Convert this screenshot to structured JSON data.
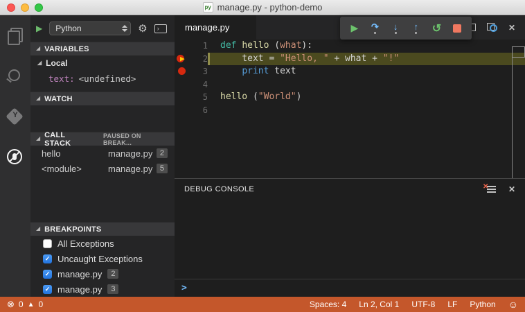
{
  "window": {
    "title": "manage.py - python-demo",
    "file_icon_label": "py"
  },
  "activity_bar": {
    "items": [
      "explorer",
      "search",
      "git",
      "debug"
    ],
    "active": "debug"
  },
  "debug_sidebar": {
    "config_dropdown": "Python",
    "git_glyph": "Y",
    "sections": {
      "variables": {
        "label": "VARIABLES",
        "scope": "Local",
        "entries": [
          {
            "name": "text:",
            "value": "<undefined>"
          }
        ]
      },
      "watch": {
        "label": "WATCH"
      },
      "call_stack": {
        "label": "CALL STACK",
        "status": "PAUSED ON BREAK...",
        "frames": [
          {
            "name": "hello",
            "file": "manage.py",
            "line": "2"
          },
          {
            "name": "<module>",
            "file": "manage.py",
            "line": "5"
          }
        ]
      },
      "breakpoints": {
        "label": "BREAKPOINTS",
        "items": [
          {
            "label": "All Exceptions",
            "checked": false
          },
          {
            "label": "Uncaught Exceptions",
            "checked": true
          },
          {
            "label": "manage.py",
            "line": "2",
            "checked": true
          },
          {
            "label": "manage.py",
            "line": "3",
            "checked": true
          }
        ]
      }
    }
  },
  "debug_toolbar": {
    "buttons": [
      "continue",
      "step-over",
      "step-into",
      "step-out",
      "restart",
      "stop"
    ]
  },
  "editor": {
    "tab": "manage.py",
    "lines": [
      {
        "num": "1",
        "breakpoint": null,
        "highlighted": false,
        "tokens": [
          {
            "t": "def ",
            "c": "keyword"
          },
          {
            "t": "hello ",
            "c": "function"
          },
          {
            "t": "(",
            "c": "plain"
          },
          {
            "t": "what",
            "c": "string"
          },
          {
            "t": "):",
            "c": "plain"
          }
        ]
      },
      {
        "num": "2",
        "breakpoint": "current",
        "highlighted": true,
        "tokens": [
          {
            "t": "    text = ",
            "c": "plain"
          },
          {
            "t": "\"Hello, \"",
            "c": "string"
          },
          {
            "t": " + what + ",
            "c": "plain"
          },
          {
            "t": "\"!\"",
            "c": "string"
          }
        ]
      },
      {
        "num": "3",
        "breakpoint": "plain",
        "highlighted": false,
        "tokens": [
          {
            "t": "    ",
            "c": "plain"
          },
          {
            "t": "print",
            "c": "keyword2"
          },
          {
            "t": " text",
            "c": "plain"
          }
        ]
      },
      {
        "num": "4",
        "breakpoint": null,
        "highlighted": false,
        "tokens": []
      },
      {
        "num": "5",
        "breakpoint": null,
        "highlighted": false,
        "tokens": [
          {
            "t": "hello ",
            "c": "function"
          },
          {
            "t": "(",
            "c": "plain"
          },
          {
            "t": "\"World\"",
            "c": "string"
          },
          {
            "t": ")",
            "c": "plain"
          }
        ]
      },
      {
        "num": "6",
        "breakpoint": null,
        "highlighted": false,
        "tokens": []
      }
    ]
  },
  "panel": {
    "title": "DEBUG CONSOLE",
    "input_prompt": ">"
  },
  "status_bar": {
    "errors": "0",
    "warnings": "0",
    "right_items": [
      "Spaces: 4",
      "Ln 2, Col 1",
      "UTF-8",
      "LF",
      "Python"
    ]
  },
  "colors": {
    "statusbar_debugging": "#C4572B",
    "current_line_highlight": "#4B4A1F",
    "breakpoint_red": "#D6290F",
    "instruction_pointer_yellow": "#FFCC00",
    "checkbox_blue": "#3287E8",
    "debug_play_green": "#6CC26C",
    "debug_step_blue": "#75BEFF",
    "debug_stop_red": "#F07860",
    "editor_background": "#1E1E1E",
    "sidebar_background": "#252526"
  }
}
